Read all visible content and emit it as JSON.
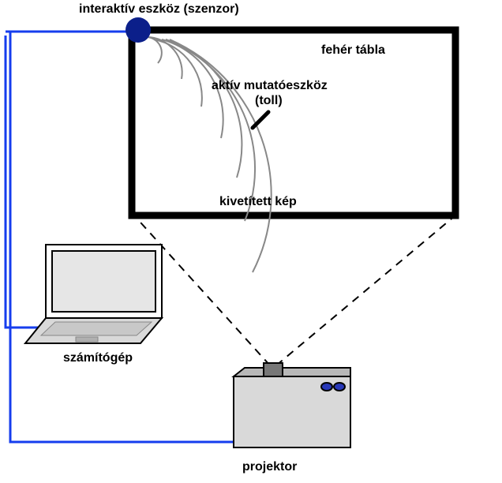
{
  "labels": {
    "sensor": "interaktív eszköz (szenzor)",
    "whiteboard": "fehér tábla",
    "pointer_line1": "aktív mutatóeszköz",
    "pointer_line2": "(toll)",
    "projected": "kivetített kép",
    "computer": "számítógép",
    "projector": "projektor"
  }
}
